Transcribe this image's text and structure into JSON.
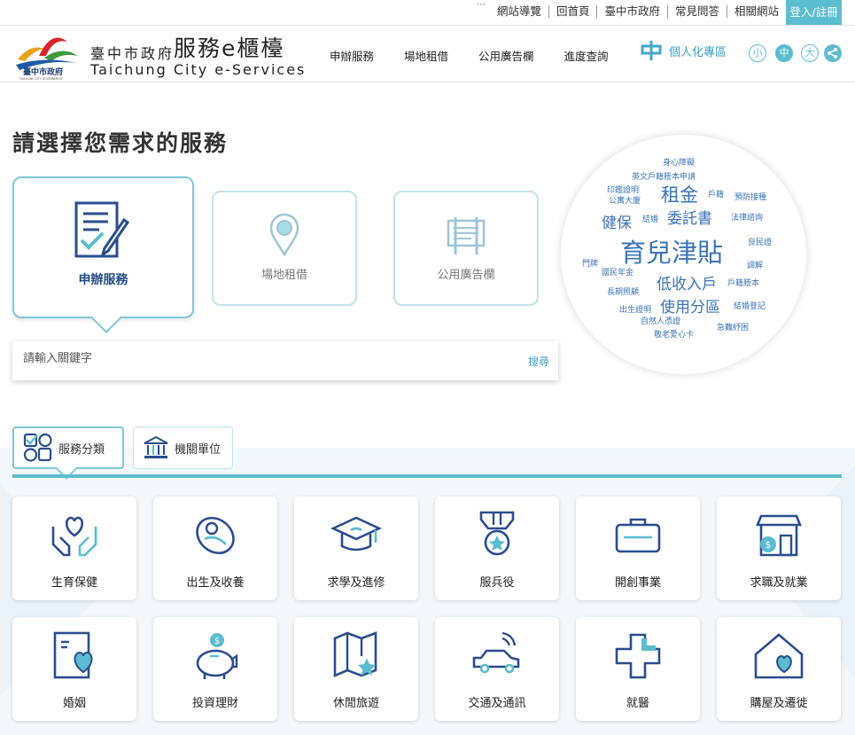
{
  "top": {
    "links": [
      "網站導覽",
      "回首頁",
      "臺中市政府",
      "常見問答",
      "相關網站"
    ],
    "login": "登入/註冊",
    "dots": "⋯"
  },
  "header": {
    "gov_name": "臺中市政府",
    "site_name": "服務e櫃檯",
    "site_en": "Taichung City e-Services",
    "logo_text": "臺中市政府",
    "logo_en": "TAICHUNG CITY GOVERNMENT",
    "nav": [
      "申辦服務",
      "場地租借",
      "公用廣告欄",
      "進度查詢"
    ],
    "personal": "個人化專區",
    "font_small": "小",
    "font_mid": "中",
    "font_large": "大"
  },
  "main": {
    "title": "請選擇您需求的服務",
    "services": [
      "申辦服務",
      "場地租借",
      "公用廣告欄"
    ],
    "search_placeholder": "請輸入關鍵字",
    "search_button": "搜尋"
  },
  "cloud": [
    "身心障礙",
    "英文戶籍謄本申請",
    "印鑑證明",
    "戶籍",
    "公寓大廈",
    "預防接種",
    "租金",
    "結婚",
    "委託書",
    "健保",
    "法律諮詢",
    "育兒津貼",
    "良民證",
    "門牌",
    "國民年金",
    "調解",
    "低收入戶",
    "戶籍謄本",
    "長期照顧",
    "使用分區",
    "出生證明",
    "結婚登記",
    "自然人憑證",
    "急難紓困",
    "敬老愛心卡"
  ],
  "tabs": {
    "category": "服務分類",
    "organization": "機關單位"
  },
  "cards": [
    "生育保健",
    "出生及收養",
    "求學及進修",
    "服兵役",
    "開創事業",
    "求職及就業",
    "婚姻",
    "投資理財",
    "休閒旅遊",
    "交通及通訊",
    "就醫",
    "購屋及遷徙"
  ],
  "colors": {
    "accent": "#5bbdcf",
    "icon": "#2a4d8f",
    "keyword": "#3b74b8"
  }
}
